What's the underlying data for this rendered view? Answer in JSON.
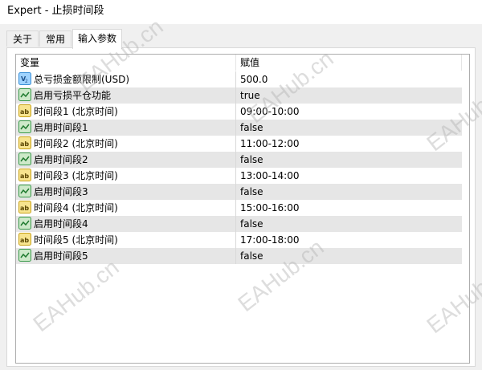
{
  "window": {
    "title": "Expert - 止损时间段"
  },
  "tabs": [
    {
      "label": "关于",
      "active": false
    },
    {
      "label": "常用",
      "active": false
    },
    {
      "label": "输入参数",
      "active": true
    }
  ],
  "table": {
    "columns": [
      "变量",
      "赋值"
    ],
    "rows": [
      {
        "icon": "double-value-icon",
        "name": "总亏损金额限制(USD)",
        "value": "500.0"
      },
      {
        "icon": "bool-value-icon",
        "name": "启用亏损平仓功能",
        "value": "true"
      },
      {
        "icon": "string-value-icon",
        "name": "时间段1 (北京时间)",
        "value": "09:00-10:00"
      },
      {
        "icon": "bool-value-icon",
        "name": "启用时间段1",
        "value": "false"
      },
      {
        "icon": "string-value-icon",
        "name": "时间段2 (北京时间)",
        "value": "11:00-12:00"
      },
      {
        "icon": "bool-value-icon",
        "name": "启用时间段2",
        "value": "false"
      },
      {
        "icon": "string-value-icon",
        "name": "时间段3 (北京时间)",
        "value": "13:00-14:00"
      },
      {
        "icon": "bool-value-icon",
        "name": "启用时间段3",
        "value": "false"
      },
      {
        "icon": "string-value-icon",
        "name": "时间段4 (北京时间)",
        "value": "15:00-16:00"
      },
      {
        "icon": "bool-value-icon",
        "name": "启用时间段4",
        "value": "false"
      },
      {
        "icon": "string-value-icon",
        "name": "时间段5 (北京时间)",
        "value": "17:00-18:00"
      },
      {
        "icon": "bool-value-icon",
        "name": "启用时间段5",
        "value": "false"
      }
    ]
  },
  "watermark": {
    "text": "EAHub.cn"
  }
}
